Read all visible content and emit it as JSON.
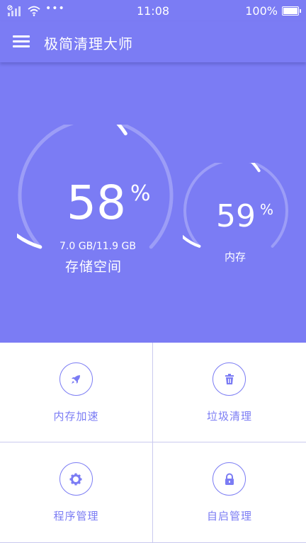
{
  "status_bar": {
    "time": "11:08",
    "battery": "100%",
    "more": "•••",
    "icons": [
      "signal-icon",
      "wifi-icon",
      "battery-icon"
    ]
  },
  "app_bar": {
    "title": "极简清理大师",
    "menu_icon": "menu-icon"
  },
  "storage": {
    "value": "58",
    "sign": "%",
    "capacity": "7.0 GB/11.9 GB",
    "label": "存储空间",
    "percent": 58
  },
  "memory": {
    "value": "59",
    "sign": "%",
    "label": "内存",
    "percent": 59
  },
  "actions": [
    {
      "label": "内存加速",
      "icon": "rocket-icon"
    },
    {
      "label": "垃圾清理",
      "icon": "trash-icon"
    },
    {
      "label": "程序管理",
      "icon": "gear-icon"
    },
    {
      "label": "自启管理",
      "icon": "lock-icon"
    }
  ],
  "colors": {
    "accent": "#7b7cf4",
    "track": "#9c9df7",
    "foreground": "#ffffff"
  }
}
